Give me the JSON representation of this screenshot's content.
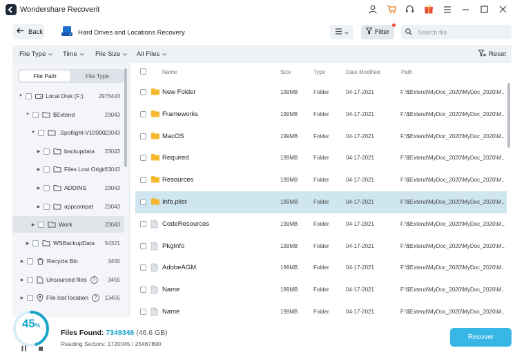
{
  "app": {
    "title": "Wondershare Recoverit"
  },
  "header": {
    "back_label": "Back",
    "page_title": "Hard Drives and Locations Recovery",
    "filter_label": "Filter",
    "search_placeholder": "Search file"
  },
  "filterbar": {
    "items": [
      "File Type",
      "Time",
      "File Size",
      "All Files"
    ],
    "reset_label": "Reset"
  },
  "sidebar": {
    "tabs": [
      "File Path",
      "File Type"
    ],
    "active_tab": "File Path",
    "tree": [
      {
        "label": "Local Disk (F:)",
        "count": "2976443",
        "icon": "drive-icon",
        "caret": "down"
      },
      {
        "label": "$Extend",
        "count": "23043",
        "icon": "folder-icon",
        "caret": "down"
      },
      {
        "label": ".Spotlight-V10000...",
        "count": "23043",
        "icon": "folder-icon",
        "caret": "down"
      },
      {
        "label": "backupdata",
        "count": "23043",
        "icon": "folder-icon",
        "caret": "right"
      },
      {
        "label": "Files Lost Origin...",
        "count": "23043",
        "icon": "folder-icon",
        "caret": "right"
      },
      {
        "label": "ADDINS",
        "count": "23043",
        "icon": "folder-icon",
        "caret": "right"
      },
      {
        "label": "appcompat",
        "count": "23043",
        "icon": "folder-icon",
        "caret": "right"
      },
      {
        "label": "Work",
        "count": "23043",
        "icon": "folder-icon",
        "caret": "right",
        "selected": true
      },
      {
        "label": "WSBackupData",
        "count": "54321",
        "icon": "folder-icon",
        "caret": "right"
      },
      {
        "label": "Recycle Bin",
        "count": "3455",
        "icon": "recycle-bin-icon",
        "caret": "right"
      },
      {
        "label": "Unsourced files",
        "count": "3455",
        "icon": "file-icon",
        "caret": "right",
        "help": true
      },
      {
        "label": "File lost location",
        "count": "13455",
        "icon": "location-icon",
        "caret": "right",
        "help": true
      }
    ]
  },
  "table": {
    "columns": [
      "Name",
      "Size",
      "Type",
      "Date Modified",
      "Path"
    ],
    "rows": [
      {
        "name": "New Folder",
        "size": "199MB",
        "type": "Folder",
        "date": "04-17-2021",
        "path": "F:\\$Extend\\MyDoc_2020\\MyDoc_2020\\M...",
        "icon": "folder"
      },
      {
        "name": "Frameworks",
        "size": "199MB",
        "type": "Folder",
        "date": "04-17-2021",
        "path": "F:\\$Extend\\MyDoc_2020\\MyDoc_2020\\M...",
        "icon": "folder"
      },
      {
        "name": "MacOS",
        "size": "199MB",
        "type": "Folder",
        "date": "04-17-2021",
        "path": "F:\\$Extend\\MyDoc_2020\\MyDoc_2020\\M...",
        "icon": "folder"
      },
      {
        "name": "Required",
        "size": "199MB",
        "type": "Folder",
        "date": "04-17-2021",
        "path": "F:\\$Extend\\MyDoc_2020\\MyDoc_2020\\M...",
        "icon": "folder"
      },
      {
        "name": "Resources",
        "size": "199MB",
        "type": "Folder",
        "date": "04-17-2021",
        "path": "F:\\$Extend\\MyDoc_2020\\MyDoc_2020\\M...",
        "icon": "folder"
      },
      {
        "name": "Info.plist",
        "size": "199MB",
        "type": "Folder",
        "date": "04-17-2021",
        "path": "F:\\$Extend\\MyDoc_2020\\MyDoc_2020\\M...",
        "icon": "folder",
        "highlight": true
      },
      {
        "name": "CodeResources",
        "size": "199MB",
        "type": "Folder",
        "date": "04-17-2021",
        "path": "F:\\$Extend\\MyDoc_2020\\MyDoc_2020\\M...",
        "icon": "file"
      },
      {
        "name": "PkgInfo",
        "size": "199MB",
        "type": "Folder",
        "date": "04-17-2021",
        "path": "F:\\$Extend\\MyDoc_2020\\MyDoc_2020\\M...",
        "icon": "file"
      },
      {
        "name": "AdobeAGM",
        "size": "199MB",
        "type": "Folder",
        "date": "04-17-2021",
        "path": "F:\\$Extend\\MyDoc_2020\\MyDoc_2020\\M...",
        "icon": "file"
      },
      {
        "name": "Name",
        "size": "199MB",
        "type": "Folder",
        "date": "04-17-2021",
        "path": "F:\\$Extend\\MyDoc_2020\\MyDoc_2020\\M...",
        "icon": "file"
      },
      {
        "name": "Name",
        "size": "199MB",
        "type": "Folder",
        "date": "04-17-2021",
        "path": "F:\\$Extend\\MyDoc_2020\\MyDoc_2020\\M...",
        "icon": "file"
      }
    ]
  },
  "footer": {
    "progress_number": "45",
    "progress_unit": "%",
    "progress_fraction": 0.45,
    "files_found_label": "Files Found:",
    "files_found_count": "7349346",
    "files_found_size": "(46.6 GB)",
    "reading_sectors": "Reading Sectors: 1720045 / 25467890",
    "recover_label": "Recover"
  },
  "colors": {
    "accent": "#38b6e6",
    "progress": "#16a4c8",
    "folder": "#f5b82e",
    "highlight_row": "#cfe6f0",
    "notification_dot": "#f04c3e"
  }
}
